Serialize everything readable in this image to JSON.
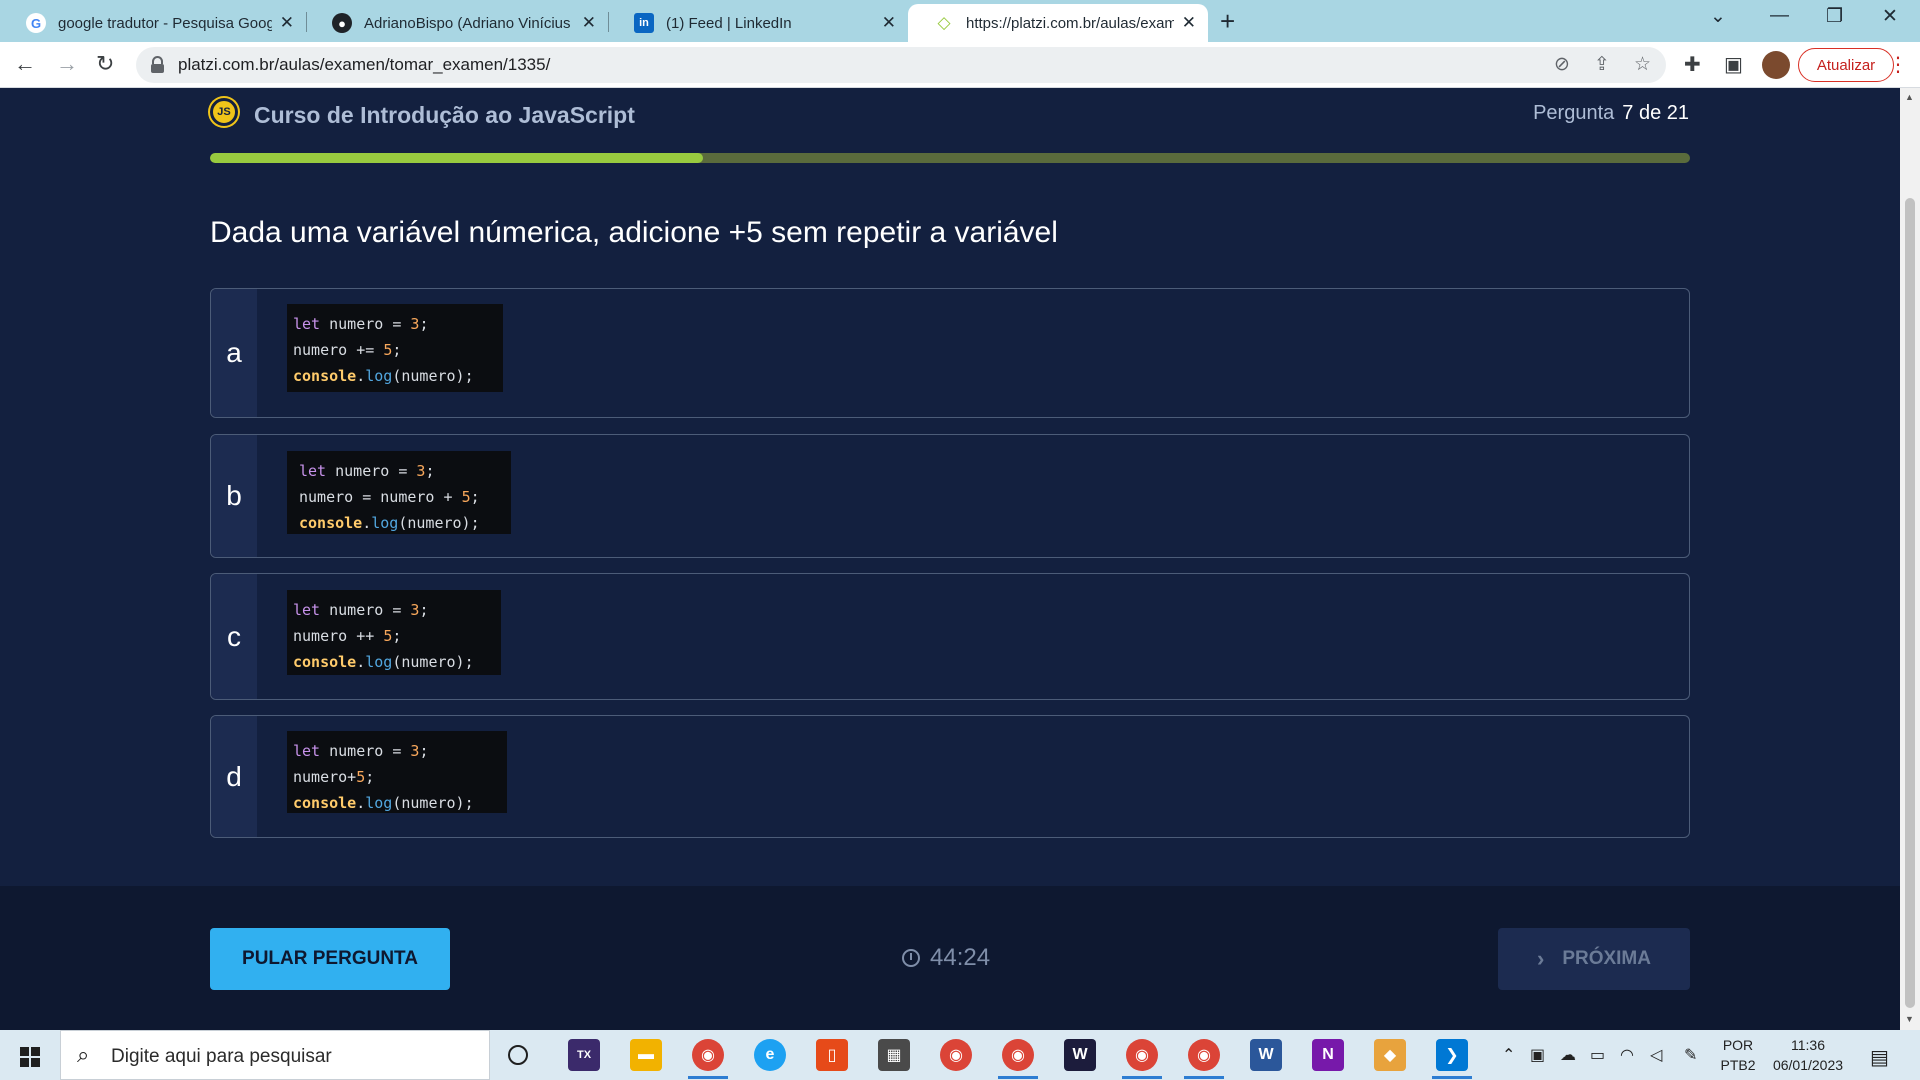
{
  "browser": {
    "tabs": [
      {
        "title": "google tradutor - Pesquisa Goog",
        "icon": "google-icon",
        "close": "✕"
      },
      {
        "title": "AdrianoBispo (Adriano Vinícius B",
        "icon": "github-icon",
        "close": "✕"
      },
      {
        "title": "(1) Feed | LinkedIn",
        "icon": "linkedin-icon",
        "close": "✕"
      },
      {
        "title": "https://platzi.com.br/aulas/exam",
        "icon": "platzi-icon",
        "close": "✕"
      }
    ],
    "url": "platzi.com.br/aulas/examen/tomar_examen/1335/",
    "update_label": "Atualizar"
  },
  "exam": {
    "course_logo": "JS",
    "course_title": "Curso de Introdução ao JavaScript",
    "counter_label": "Pergunta",
    "counter_value": "7 de 21",
    "progress": 0.333,
    "question": "Dada uma variável númerica, adicione +5 sem repetir a variável",
    "options": [
      {
        "letter": "a",
        "lines": [
          "let numero = 3;",
          "numero += 5;",
          "console.log(numero);"
        ]
      },
      {
        "letter": "b",
        "lines": [
          "let numero = 3;",
          "numero = numero + 5;",
          "console.log(numero);"
        ]
      },
      {
        "letter": "c",
        "lines": [
          "let numero = 3;",
          "numero ++ 5;",
          "console.log(numero);"
        ]
      },
      {
        "letter": "d",
        "lines": [
          "let numero = 3;",
          "numero+5;",
          "console.log(numero);"
        ]
      }
    ],
    "skip_label": "PULAR PERGUNTA",
    "timer": "44:24",
    "next_label": "PRÓXIMA"
  },
  "taskbar": {
    "search_placeholder": "Digite aqui para pesquisar",
    "lang_top": "POR",
    "lang_bottom": "PTB2",
    "time": "11:36",
    "date": "06/01/2023"
  },
  "colors": {
    "page_bg": "#13203f",
    "progress_fill": "#98ca3f",
    "skip_button": "#31b0f0",
    "next_button": "#1c2b50"
  }
}
